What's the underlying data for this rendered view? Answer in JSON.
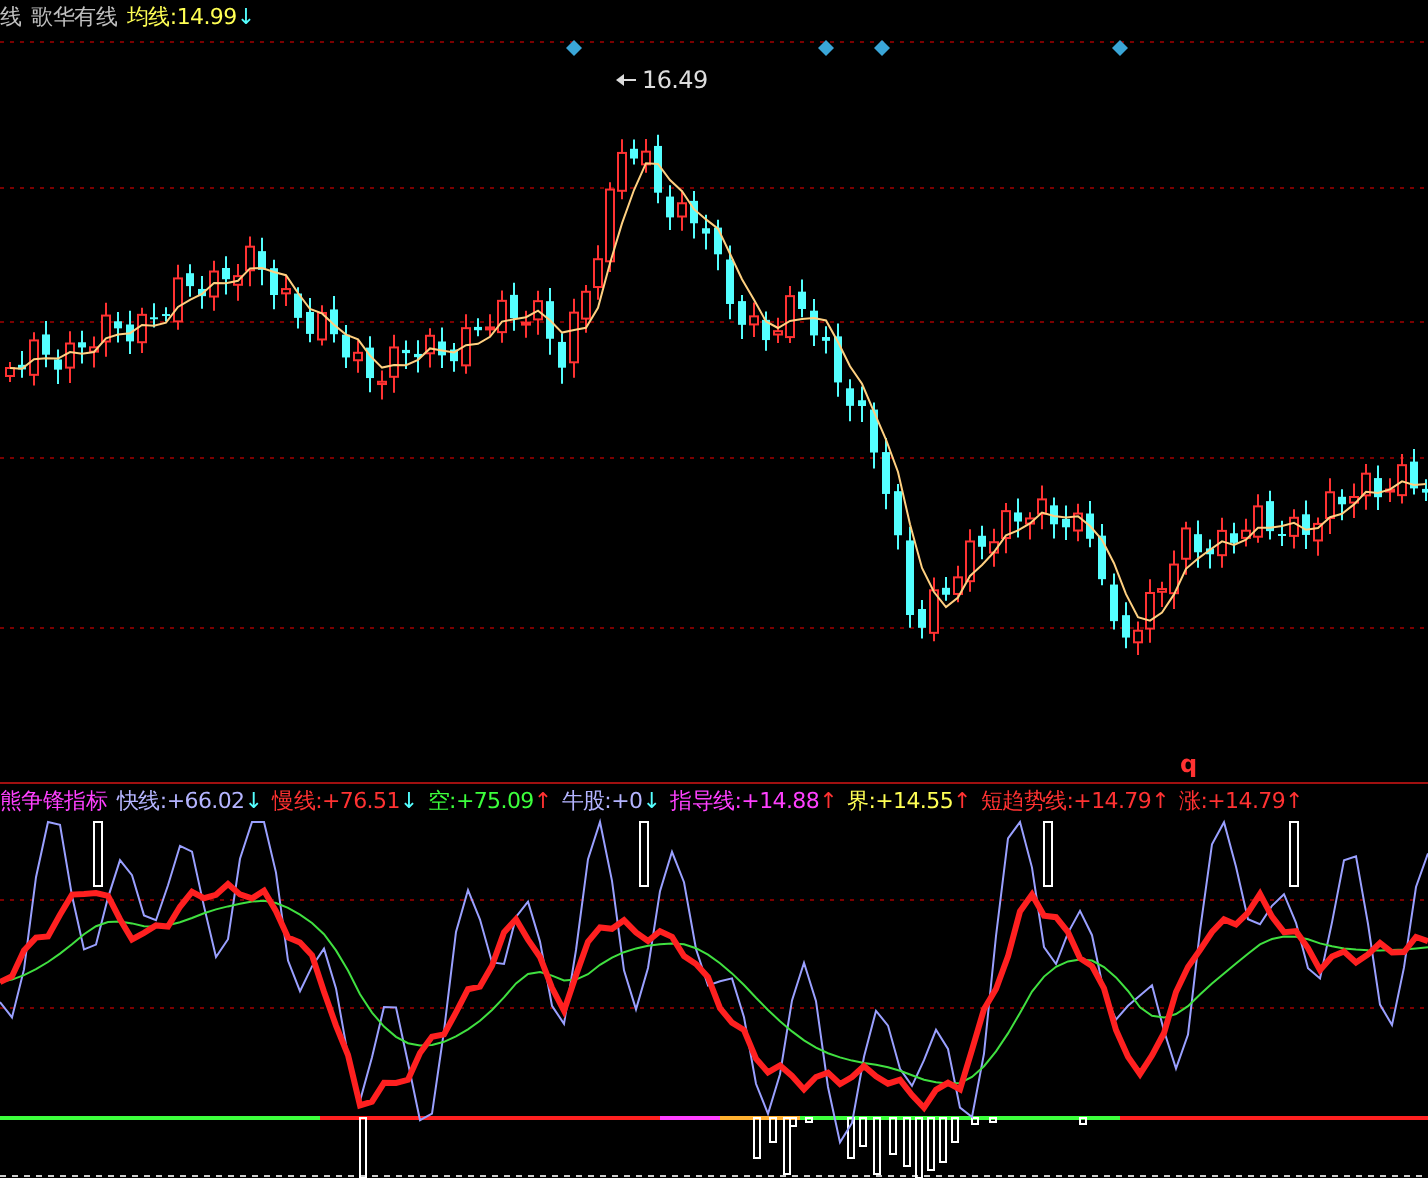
{
  "price_panel": {
    "legend": [
      {
        "label": "线",
        "color": "#c0c0c0"
      },
      {
        "label": "歌华有线",
        "color": "#c0c0c0"
      },
      {
        "label": "均线:",
        "value": "14.99",
        "arrow": "↓",
        "rising": false,
        "color": "#ffff54"
      }
    ],
    "peak_label": "16.49"
  },
  "indicator_panel": {
    "marker": "q",
    "title": "熊争锋指标",
    "legend": [
      {
        "label": "快线:",
        "value": "+66.02",
        "arrow": "↓",
        "rising": false,
        "color": "#b4b4ff"
      },
      {
        "label": "慢线:",
        "value": "+76.51",
        "arrow": "↓",
        "rising": false,
        "color": "#ff3232"
      },
      {
        "label": "空:",
        "value": "+75.09",
        "arrow": "↑",
        "rising": true,
        "color": "#3cff3c"
      },
      {
        "label": "牛股:",
        "value": "+0",
        "arrow": "↓",
        "rising": false,
        "color": "#b4b4ff"
      },
      {
        "label": "指导线:",
        "value": "+14.88",
        "arrow": "↑",
        "rising": true,
        "color": "#ff40ff"
      },
      {
        "label": "界:",
        "value": "+14.55",
        "arrow": "↑",
        "rising": true,
        "color": "#ffff54"
      },
      {
        "label": "短趋势线:",
        "value": "+14.79",
        "arrow": "↑",
        "rising": true,
        "color": "#ff3232"
      },
      {
        "label": "涨:",
        "value": "+14.79",
        "arrow": "↑",
        "rising": true,
        "color": "#ff3232"
      }
    ]
  }
}
